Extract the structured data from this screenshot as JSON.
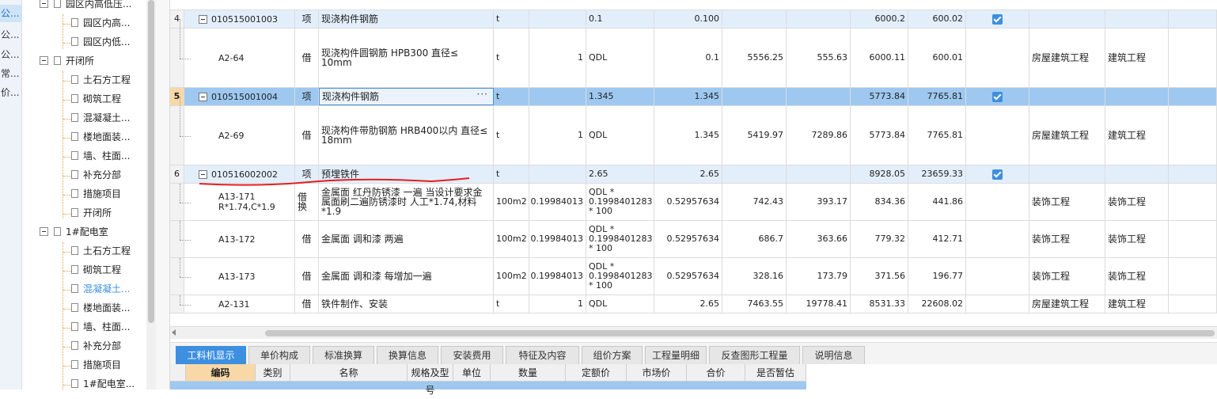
{
  "left_strip": {
    "items": [
      "公...",
      "公...",
      "公...",
      "常...",
      "价..."
    ]
  },
  "tree": {
    "nodes": [
      {
        "label": "园区内高低压...",
        "kind": "folder",
        "level": 1
      },
      {
        "label": "园区内高...",
        "kind": "doc",
        "level": 2
      },
      {
        "label": "园区内低...",
        "kind": "doc",
        "level": 2
      },
      {
        "label": "开闭所",
        "kind": "folder",
        "level": 1
      },
      {
        "label": "土石方工程",
        "kind": "doc",
        "level": 2
      },
      {
        "label": "砌筑工程",
        "kind": "doc",
        "level": 2
      },
      {
        "label": "混凝凝土...",
        "kind": "doc",
        "level": 2
      },
      {
        "label": "楼地面装...",
        "kind": "doc",
        "level": 2
      },
      {
        "label": "墙、柱面...",
        "kind": "doc",
        "level": 2
      },
      {
        "label": "补充分部",
        "kind": "doc",
        "level": 2
      },
      {
        "label": "措施项目",
        "kind": "doc",
        "level": 2
      },
      {
        "label": "开闭所",
        "kind": "doc",
        "level": 2
      },
      {
        "label": "1#配电室",
        "kind": "folder",
        "level": 1
      },
      {
        "label": "土石方工程",
        "kind": "doc",
        "level": 2
      },
      {
        "label": "砌筑工程",
        "kind": "doc",
        "level": 2
      },
      {
        "label": "混凝凝土...",
        "kind": "doc",
        "level": 2,
        "highlight": true
      },
      {
        "label": "楼地面装...",
        "kind": "doc",
        "level": 2
      },
      {
        "label": "墙、柱面...",
        "kind": "doc",
        "level": 2
      },
      {
        "label": "补充分部",
        "kind": "doc",
        "level": 2
      },
      {
        "label": "措施项目",
        "kind": "doc",
        "level": 2
      },
      {
        "label": "1#配电室...",
        "kind": "doc",
        "level": 2
      }
    ]
  },
  "grid": {
    "rows": [
      {
        "num": "4",
        "kind": "parent",
        "code": "010515001003",
        "type": "项",
        "name": "现浇构件钢筋",
        "unit": "t",
        "qty": "",
        "expr": "0.1",
        "eqty": "0.100",
        "p1": "",
        "p2": "",
        "p3": "6000.2",
        "p4": "600.02",
        "checked": true,
        "cat1": "",
        "cat2": ""
      },
      {
        "num": "",
        "kind": "child",
        "code": "A2-64",
        "type": "借",
        "name": "现浇构件圆钢筋 HPB300 直径≤ 10mm",
        "unit": "t",
        "qty": "1",
        "expr": "QDL",
        "eqty": "0.1",
        "p1": "5556.25",
        "p2": "555.63",
        "p3": "6000.11",
        "p4": "600.01",
        "checked": false,
        "cat1": "房屋建筑工程",
        "cat2": "建筑工程"
      },
      {
        "num": "5",
        "kind": "selected",
        "code": "010515001004",
        "type": "项",
        "name": "现浇构件钢筋",
        "unit": "t",
        "qty": "",
        "expr": "1.345",
        "eqty": "1.345",
        "p1": "",
        "p2": "",
        "p3": "5773.84",
        "p4": "7765.81",
        "checked": true,
        "cat1": "",
        "cat2": "",
        "dots": "···"
      },
      {
        "num": "",
        "kind": "child",
        "code": "A2-69",
        "type": "借",
        "name": "现浇构件带肋钢筋 HRB400以内 直径≤ 18mm",
        "unit": "t",
        "qty": "1",
        "expr": "QDL",
        "eqty": "1.345",
        "p1": "5419.97",
        "p2": "7289.86",
        "p3": "5773.84",
        "p4": "7765.81",
        "checked": false,
        "cat1": "房屋建筑工程",
        "cat2": "建筑工程"
      },
      {
        "num": "6",
        "kind": "parent",
        "code": "010516002002",
        "type": "项",
        "name": "预埋铁件",
        "unit": "t",
        "qty": "",
        "expr": "2.65",
        "eqty": "2.65",
        "p1": "",
        "p2": "",
        "p3": "8928.05",
        "p4": "23659.33",
        "checked": true,
        "cat1": "",
        "cat2": ""
      },
      {
        "num": "",
        "kind": "child",
        "code": "A13-171 R*1.74,C*1.9",
        "type": "借换",
        "name": "金属面 红丹防锈漆 一遍 当设计要求金属面刷二遍防锈漆时 人工*1.74,材料*1.9",
        "unit": "100m2",
        "qty": "0.19984013",
        "expr": "QDL * 0.1998401283 * 100",
        "eqty": "0.52957634",
        "p1": "742.43",
        "p2": "393.17",
        "p3": "834.36",
        "p4": "441.86",
        "checked": false,
        "cat1": "装饰工程",
        "cat2": "装饰工程"
      },
      {
        "num": "",
        "kind": "child",
        "code": "A13-172",
        "type": "借",
        "name": "金属面 调和漆 两遍",
        "unit": "100m2",
        "qty": "0.19984013",
        "expr": "QDL * 0.1998401283 * 100",
        "eqty": "0.52957634",
        "p1": "686.7",
        "p2": "363.66",
        "p3": "779.32",
        "p4": "412.71",
        "checked": false,
        "cat1": "装饰工程",
        "cat2": "装饰工程"
      },
      {
        "num": "",
        "kind": "child",
        "code": "A13-173",
        "type": "借",
        "name": "金属面 调和漆 每增加一遍",
        "unit": "100m2",
        "qty": "0.19984013",
        "expr": "QDL * 0.1998401283 * 100",
        "eqty": "0.52957634",
        "p1": "328.16",
        "p2": "173.79",
        "p3": "371.56",
        "p4": "196.77",
        "checked": false,
        "cat1": "装饰工程",
        "cat2": "装饰工程"
      },
      {
        "num": "",
        "kind": "child",
        "code": "A2-131",
        "type": "借",
        "name": "铁件制作、安装",
        "unit": "t",
        "qty": "1",
        "expr": "QDL",
        "eqty": "2.65",
        "p1": "7463.55",
        "p2": "19778.41",
        "p3": "8531.33",
        "p4": "22608.02",
        "checked": false,
        "cat1": "房屋建筑工程",
        "cat2": "建筑工程"
      }
    ]
  },
  "tabs": [
    "工料机显示",
    "单价构成",
    "标准换算",
    "换算信息",
    "安装费用",
    "特征及内容",
    "组价方案",
    "工程量明细",
    "反查图形工程量",
    "说明信息"
  ],
  "detail": {
    "columns": [
      "编码",
      "类别",
      "名称",
      "规格及型号",
      "单位",
      "数量",
      "定额价",
      "市场价",
      "合价",
      "是否暂估"
    ]
  },
  "colors": {
    "selected_row": "#9ec8f0",
    "parent_row": "#e3eefb",
    "active_tab": "#3d8fe0",
    "annotation_red": "#e02020"
  }
}
